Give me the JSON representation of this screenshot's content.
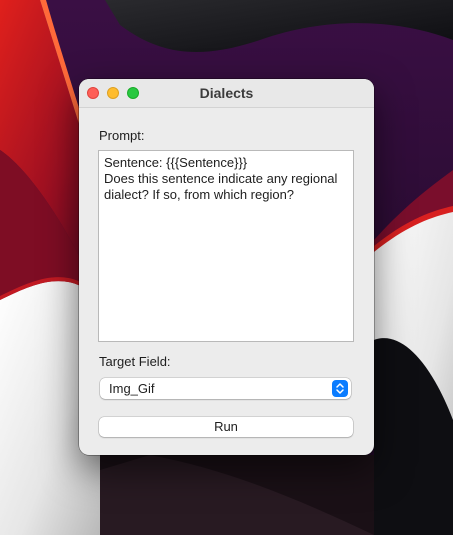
{
  "window": {
    "title": "Dialects"
  },
  "prompt": {
    "label": "Prompt:",
    "value": "Sentence: {{{Sentence}}}\nDoes this sentence indicate any regional dialect? If so, from which region?"
  },
  "target_field": {
    "label": "Target Field:",
    "selected": "Img_Gif"
  },
  "actions": {
    "run_label": "Run"
  },
  "colors": {
    "window_background": "#ececec",
    "accent": "#0a7cff",
    "close": "#fe5f57",
    "minimize": "#febc2e",
    "zoom": "#28c840"
  }
}
